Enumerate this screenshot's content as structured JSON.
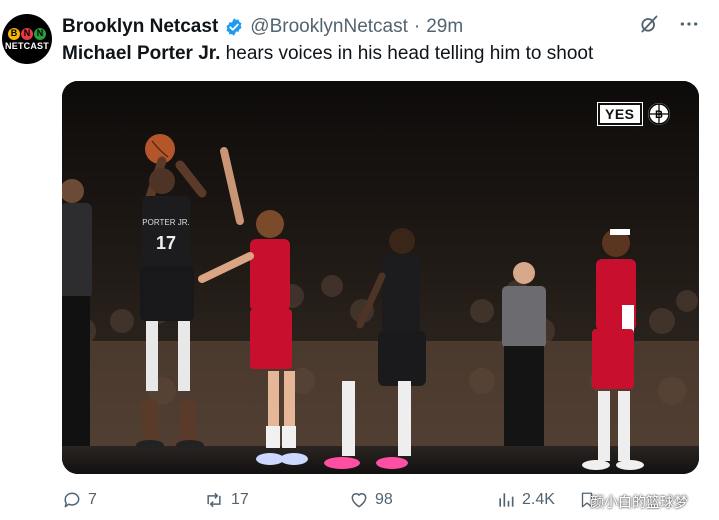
{
  "tweet": {
    "author_name": "Brooklyn Netcast",
    "handle": "@BrooklynNetcast",
    "separator": "·",
    "time": "29m",
    "mention": "Michael Porter Jr.",
    "text_rest": " hears voices in his head telling him to shoot"
  },
  "avatar": {
    "letters": [
      "B",
      "N",
      "N"
    ],
    "brand": "NETCAST",
    "dot_colors": [
      "#f5b700",
      "#e63946",
      "#2a9d3a"
    ]
  },
  "icons": {
    "verified": "verified-badge-icon",
    "grok": "grok-icon",
    "more": "more-icon"
  },
  "media": {
    "network_logo": "YES",
    "jersey_number": "17",
    "jersey_name": "PORTER JR."
  },
  "actions": {
    "replies": "7",
    "reposts": "17",
    "likes": "98",
    "views": "2.4K"
  },
  "watermark": "颜小白的篮球梦",
  "colors": {
    "text_primary": "#0f1419",
    "text_secondary": "#536471",
    "verified_blue": "#1d9bf0",
    "hawks_red": "#c8102e"
  }
}
